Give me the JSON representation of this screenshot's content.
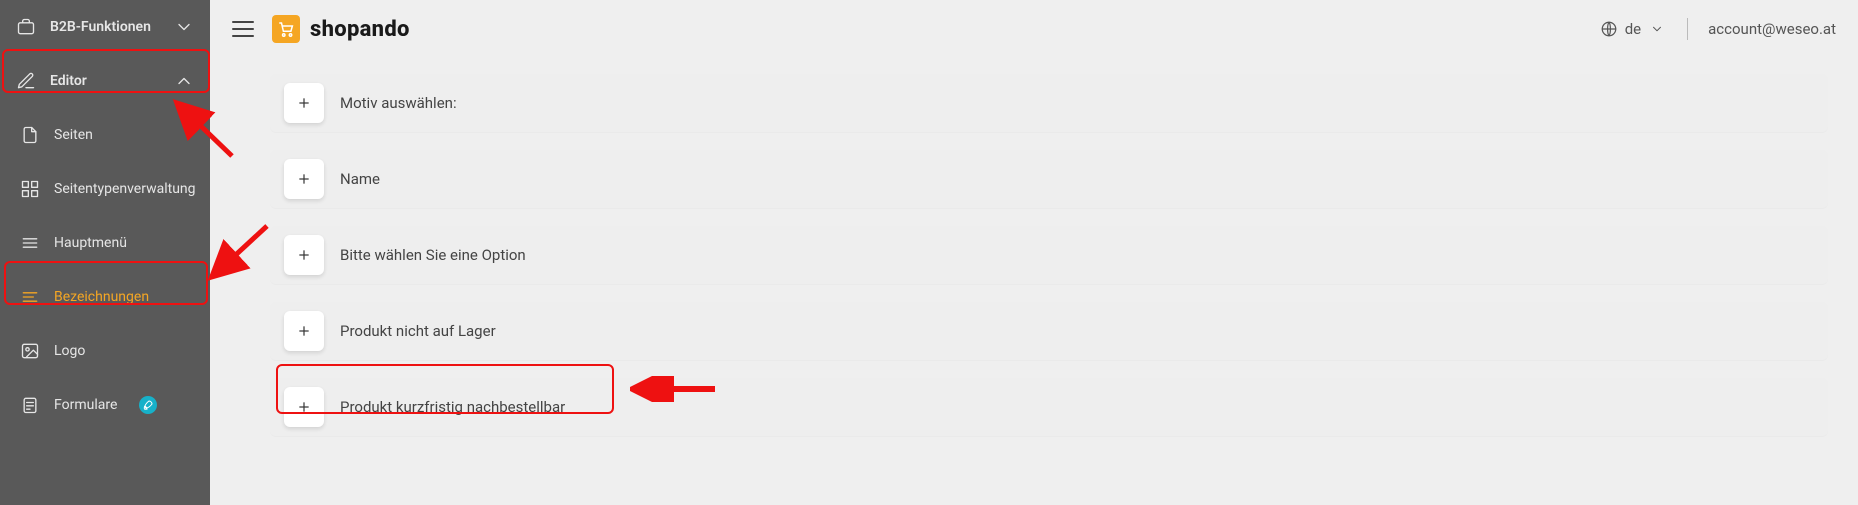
{
  "brand": {
    "name": "shopando"
  },
  "topbar": {
    "language_code": "de",
    "account_email": "account@weseo.at"
  },
  "sidebar": {
    "b2b_label": "B2B-Funktionen",
    "editor_label": "Editor",
    "items": [
      {
        "label": "Seiten"
      },
      {
        "label": "Seitentypenverwaltung"
      },
      {
        "label": "Hauptmenü"
      },
      {
        "label": "Bezeichnungen"
      },
      {
        "label": "Logo"
      },
      {
        "label": "Formulare"
      }
    ]
  },
  "rows": [
    {
      "label": "Motiv auswählen:"
    },
    {
      "label": "Name"
    },
    {
      "label": "Bitte wählen Sie eine Option"
    },
    {
      "label": "Produkt nicht auf Lager"
    },
    {
      "label": "Produkt kurzfristig nachbestellbar"
    }
  ]
}
